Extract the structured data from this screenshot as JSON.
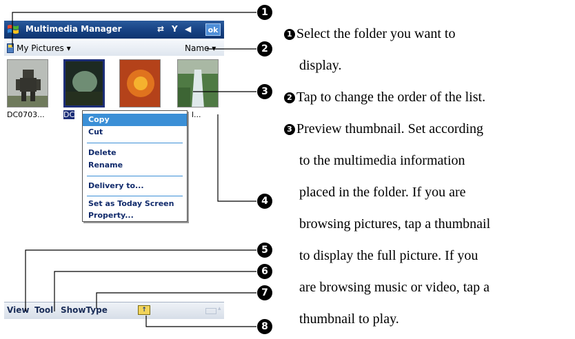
{
  "window": {
    "title": "Multimedia Manager",
    "ok_label": "ok",
    "status_icons": [
      "⇄",
      "Y",
      "◀"
    ]
  },
  "folder_bar": {
    "folder": "My Pictures",
    "sort": "Name"
  },
  "thumbnails": [
    {
      "caption": "DC0703...",
      "selected": false
    },
    {
      "caption": "DC",
      "selected": true
    },
    {
      "caption": "",
      "selected": false
    },
    {
      "caption": "l...",
      "selected": false
    }
  ],
  "context_menu": {
    "items": [
      "Copy",
      "Cut",
      "Delete",
      "Rename",
      "Delivery to...",
      "Set as Today Screen",
      "Property..."
    ],
    "highlighted": "Copy"
  },
  "bottom_menu": {
    "view": "View",
    "tool": "Tool",
    "show_type": "ShowType",
    "up_icon": "up-folder-icon"
  },
  "callouts": [
    "1",
    "2",
    "3",
    "4",
    "5",
    "6",
    "7",
    "8"
  ],
  "descriptions": [
    {
      "num": "1",
      "lines": [
        "Select the folder you want to",
        "display."
      ]
    },
    {
      "num": "2",
      "lines": [
        "Tap to change the order of the list."
      ]
    },
    {
      "num": "3",
      "lines": [
        "Preview thumbnail. Set according",
        "to the multimedia information",
        "placed in the folder. If you are",
        "browsing pictures, tap a thumbnail",
        "to display the full picture. If you",
        "are browsing music or video, tap a",
        "thumbnail to play."
      ]
    }
  ]
}
